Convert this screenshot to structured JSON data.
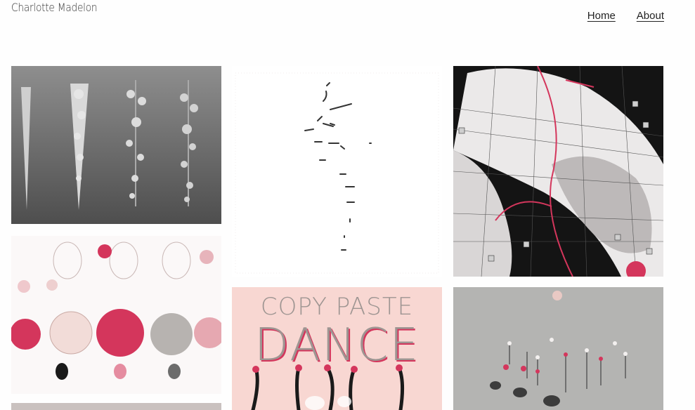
{
  "site": {
    "title": "Charlotte Madelon"
  },
  "nav": {
    "items": [
      "Home",
      "About"
    ]
  },
  "gallery": {
    "poster": {
      "line1": "COPY PASTE",
      "line2": "DANCE"
    }
  },
  "colors": {
    "accent": "#d4365c",
    "poster_bg": "#f8d7d2",
    "render_gray": "#6a6a6a"
  }
}
